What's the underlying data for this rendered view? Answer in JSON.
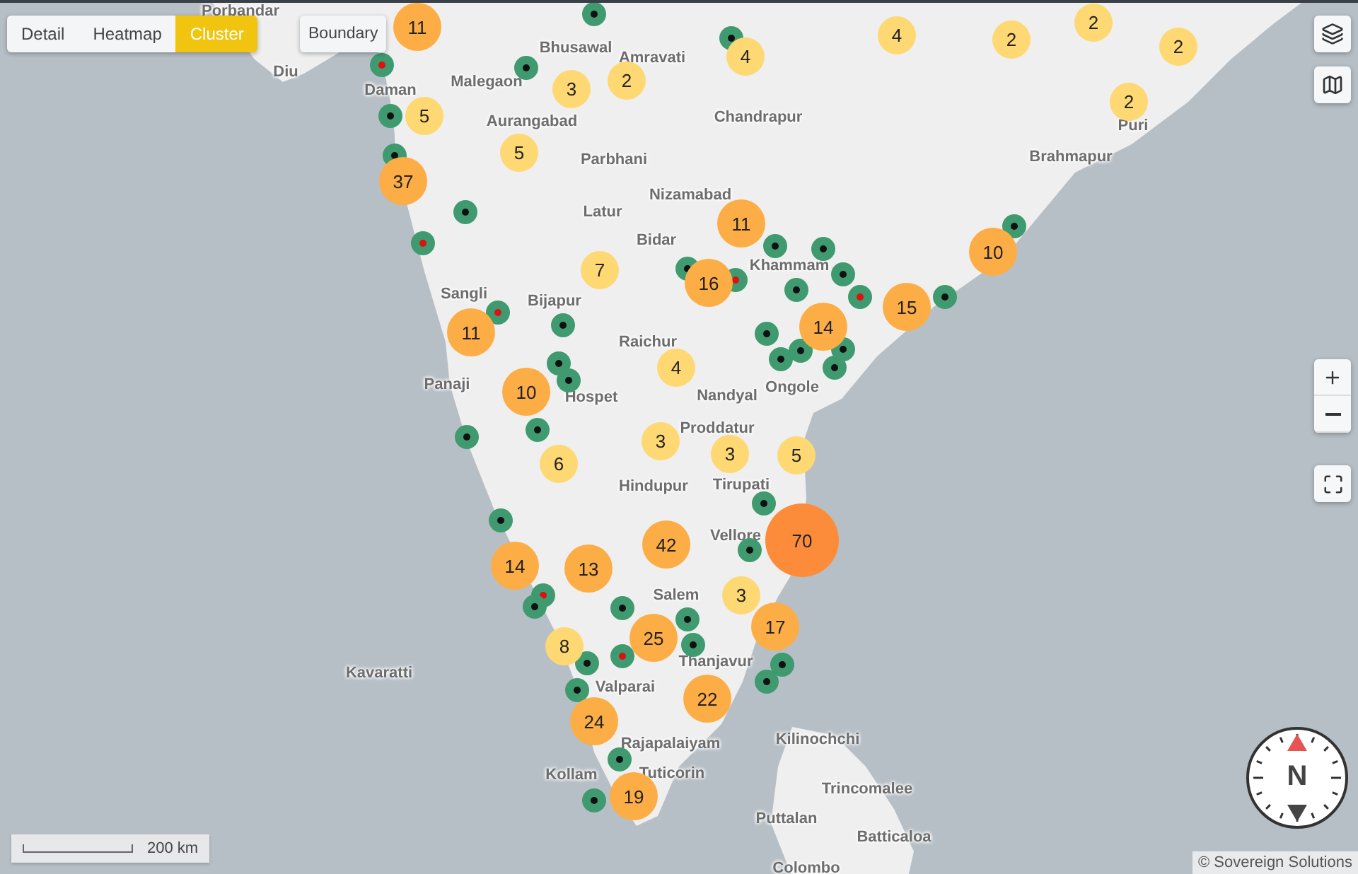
{
  "view_tabs": [
    {
      "label": "Detail",
      "selected": false
    },
    {
      "label": "Heatmap",
      "selected": false
    },
    {
      "label": "Cluster",
      "selected": true
    }
  ],
  "boundary_button": {
    "label": "Boundary"
  },
  "places": [
    "Porbandar",
    "Diu",
    "Daman",
    "Malegaon",
    "Bhusawal",
    "Amravati",
    "Aurangabad",
    "Chandrapur",
    "Parbhani",
    "Nizamabad",
    "Latur",
    "Bidar",
    "Brahmapur",
    "Puri",
    "Khammam",
    "Sangli",
    "Bijapur",
    "Raichur",
    "Nandyal",
    "Ongole",
    "Panaji",
    "Hospet",
    "Proddatur",
    "Hindupur",
    "Tirupati",
    "Vellore",
    "Kavaratti",
    "Salem",
    "Thanjavur",
    "Valparai",
    "Rajapalaiyam",
    "Kollam",
    "Tuticorin",
    "Kilinochchi",
    "Trincomalee",
    "Puttalan",
    "Batticaloa",
    "Colombo"
  ],
  "clusters": [
    {
      "count": "11",
      "color": "#fdad45"
    },
    {
      "count": "5",
      "color": "#fed872"
    },
    {
      "count": "3",
      "color": "#fed872"
    },
    {
      "count": "2",
      "color": "#fed872"
    },
    {
      "count": "4",
      "color": "#fed872"
    },
    {
      "count": "4",
      "color": "#fed872"
    },
    {
      "count": "2",
      "color": "#fed872"
    },
    {
      "count": "2",
      "color": "#fed872"
    },
    {
      "count": "2",
      "color": "#fed872"
    },
    {
      "count": "2",
      "color": "#fed872"
    },
    {
      "count": "37",
      "color": "#fdad45"
    },
    {
      "count": "5",
      "color": "#fed872"
    },
    {
      "count": "7",
      "color": "#fed872"
    },
    {
      "count": "11",
      "color": "#fdad45"
    },
    {
      "count": "16",
      "color": "#fdad45"
    },
    {
      "count": "10",
      "color": "#fdad45"
    },
    {
      "count": "15",
      "color": "#fdad45"
    },
    {
      "count": "14",
      "color": "#fdad45"
    },
    {
      "count": "11",
      "color": "#fdad45"
    },
    {
      "count": "4",
      "color": "#fed872"
    },
    {
      "count": "10",
      "color": "#fdad45"
    },
    {
      "count": "3",
      "color": "#fed872"
    },
    {
      "count": "3",
      "color": "#fed872"
    },
    {
      "count": "5",
      "color": "#fed872"
    },
    {
      "count": "6",
      "color": "#fed872"
    },
    {
      "count": "42",
      "color": "#fdad45"
    },
    {
      "count": "70",
      "color": "#fd8c3a"
    },
    {
      "count": "14",
      "color": "#fdad45"
    },
    {
      "count": "13",
      "color": "#fdad45"
    },
    {
      "count": "3",
      "color": "#fed872"
    },
    {
      "count": "17",
      "color": "#fdad45"
    },
    {
      "count": "25",
      "color": "#fdad45"
    },
    {
      "count": "8",
      "color": "#fed872"
    },
    {
      "count": "22",
      "color": "#fdad45"
    },
    {
      "count": "24",
      "color": "#fdad45"
    },
    {
      "count": "19",
      "color": "#fdad45"
    }
  ],
  "markers": [
    {
      "color": "#111111"
    },
    {
      "color": "#111111"
    },
    {
      "color": "#111111"
    },
    {
      "color": "#dd1111"
    },
    {
      "color": "#111111"
    },
    {
      "color": "#111111"
    },
    {
      "color": "#dd1111"
    },
    {
      "color": "#111111"
    },
    {
      "color": "#111111"
    },
    {
      "color": "#111111"
    },
    {
      "color": "#dd1111"
    },
    {
      "color": "#111111"
    },
    {
      "color": "#111111"
    },
    {
      "color": "#111111"
    },
    {
      "color": "#dd1111"
    },
    {
      "color": "#dd1111"
    },
    {
      "color": "#111111"
    },
    {
      "color": "#111111"
    },
    {
      "color": "#111111"
    },
    {
      "color": "#111111"
    },
    {
      "color": "#111111"
    },
    {
      "color": "#111111"
    },
    {
      "color": "#111111"
    },
    {
      "color": "#111111"
    },
    {
      "color": "#111111"
    },
    {
      "color": "#111111"
    },
    {
      "color": "#111111"
    },
    {
      "color": "#111111"
    },
    {
      "color": "#111111"
    },
    {
      "color": "#111111"
    },
    {
      "color": "#dd1111"
    },
    {
      "color": "#111111"
    },
    {
      "color": "#111111"
    },
    {
      "color": "#111111"
    },
    {
      "color": "#dd1111"
    },
    {
      "color": "#111111"
    },
    {
      "color": "#111111"
    },
    {
      "color": "#111111"
    },
    {
      "color": "#111111"
    },
    {
      "color": "#111111"
    },
    {
      "color": "#111111"
    },
    {
      "color": "#111111"
    },
    {
      "color": "#111111"
    }
  ],
  "scale": {
    "label": "200 km"
  },
  "attribution": "© Sovereign Solutions",
  "compass": {
    "label": "N"
  }
}
